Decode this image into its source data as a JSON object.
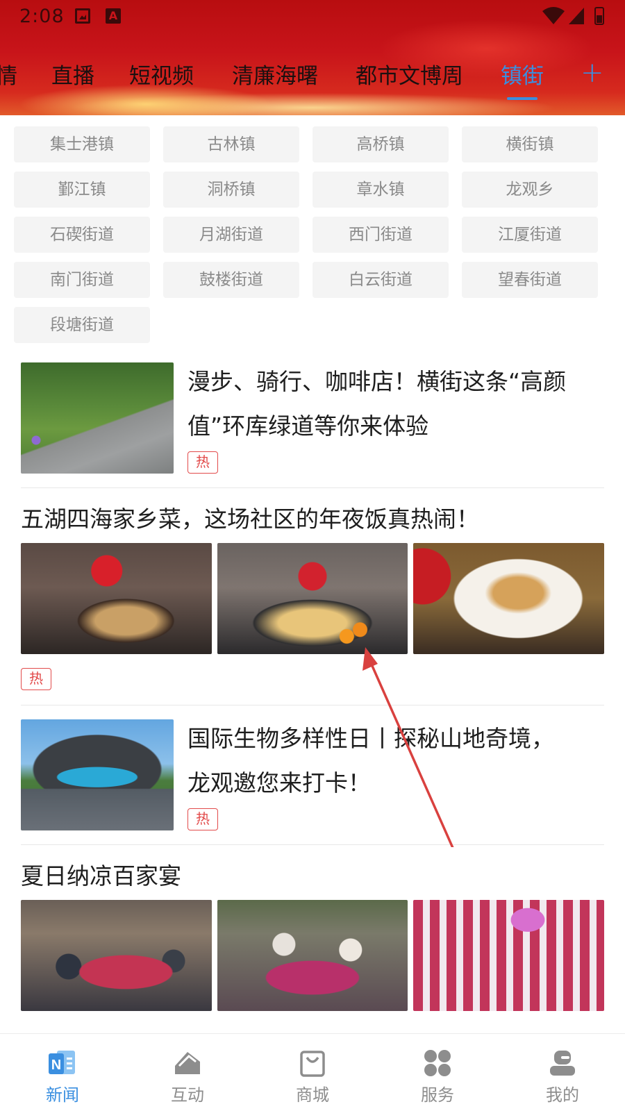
{
  "status_bar": {
    "time": "2:08",
    "sim_badge": "A"
  },
  "channel_tabs": {
    "items": [
      {
        "label": "情"
      },
      {
        "label": "直播"
      },
      {
        "label": "短视频"
      },
      {
        "label": "清廉海曙"
      },
      {
        "label": "都市文博周"
      },
      {
        "label": "镇街"
      }
    ],
    "active": "镇街",
    "add_label": "+"
  },
  "towns": [
    "集士港镇",
    "古林镇",
    "高桥镇",
    "横街镇",
    "鄞江镇",
    "洞桥镇",
    "章水镇",
    "龙观乡",
    "石碶街道",
    "月湖街道",
    "西门街道",
    "江厦街道",
    "南门街道",
    "鼓楼街道",
    "白云街道",
    "望春街道",
    "段塘街道"
  ],
  "news": [
    {
      "title_line1": "漫步、骑行、咖啡店！横街这条“高颜",
      "title_line2": "值”环库绿道等你来体验",
      "tag": "热"
    },
    {
      "title": "五湖四海家乡菜，这场社区的年夜饭真热闹！",
      "tag": "热"
    },
    {
      "title_line1": "国际生物多样性日丨探秘山地奇境，",
      "title_line2": "龙观邀您来打卡！",
      "tag": "热"
    },
    {
      "title": "夏日纳凉百家宴"
    }
  ],
  "bottom_nav": {
    "items": [
      {
        "label": "新闻",
        "icon": "news-icon"
      },
      {
        "label": "互动",
        "icon": "interact-icon"
      },
      {
        "label": "商城",
        "icon": "shop-bag-icon"
      },
      {
        "label": "服务",
        "icon": "services-grid-icon"
      },
      {
        "label": "我的",
        "icon": "profile-icon"
      }
    ],
    "active": "新闻"
  },
  "colors": {
    "accent": "#3a8fe0",
    "hot_tag": "#e24a4a",
    "header_red": "#c8141a",
    "arrow": "#d9413f"
  }
}
